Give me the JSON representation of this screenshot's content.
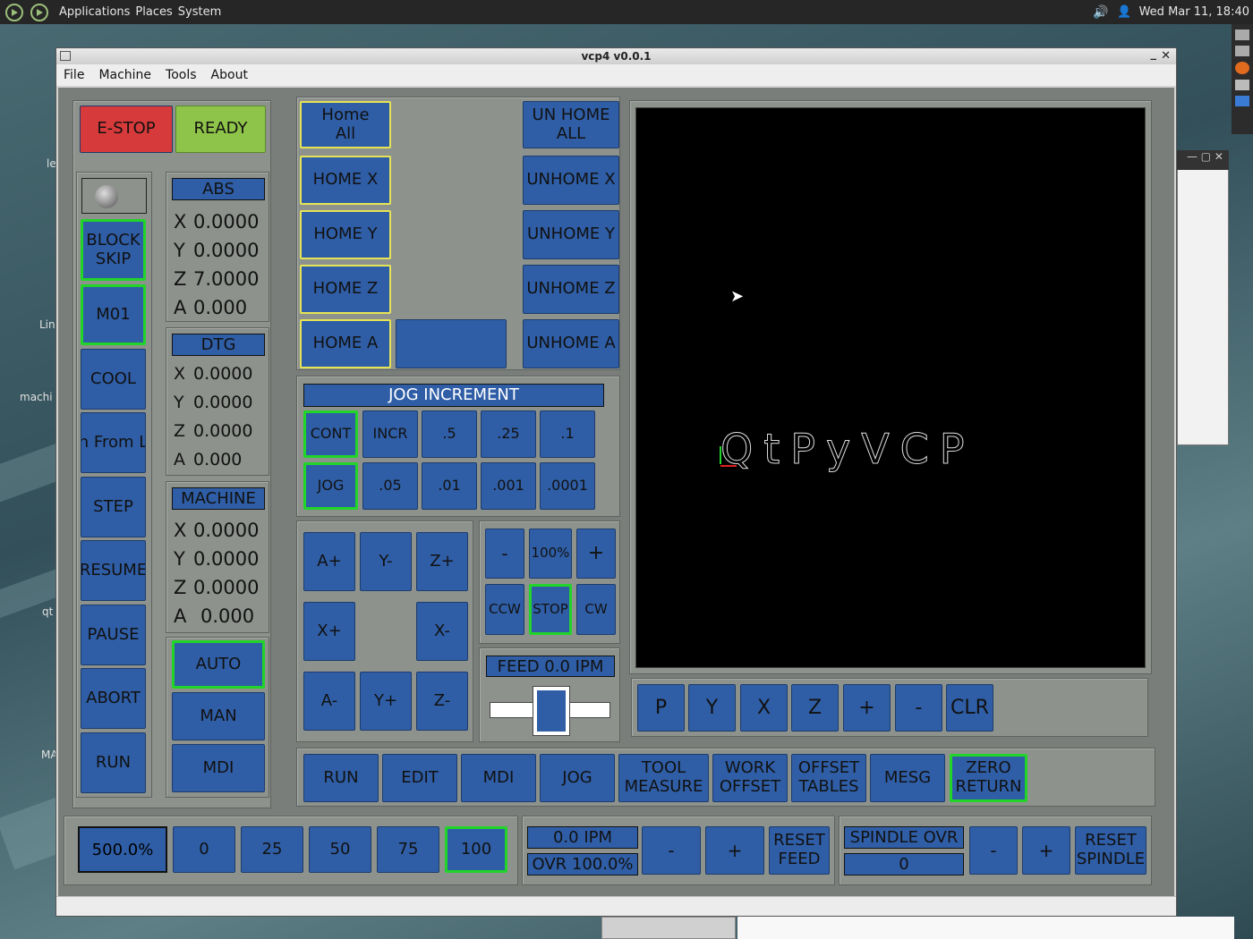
{
  "top_panel": {
    "menus": [
      "Applications",
      "Places",
      "System"
    ],
    "clock": "Wed Mar 11, 18:40"
  },
  "desktop_labels": [
    "le",
    "Lin",
    "machi",
    "qt",
    "MA"
  ],
  "window": {
    "title": "vcp4 v0.0.1",
    "menu": [
      "File",
      "Machine",
      "Tools",
      "About"
    ]
  },
  "estop_label": "E-STOP",
  "ready_label": "READY",
  "left_buttons": [
    "BLOCK\nSKIP",
    "M01",
    "COOL",
    "n From L",
    "STEP",
    "RESUME",
    "PAUSE",
    "ABORT",
    "RUN"
  ],
  "dro": {
    "abs_header": "ABS",
    "abs": [
      [
        "X",
        "0.0000"
      ],
      [
        "Y",
        "0.0000"
      ],
      [
        "Z",
        "7.0000"
      ],
      [
        "A",
        "0.000"
      ]
    ],
    "dtg_header": "DTG",
    "dtg": [
      [
        "X",
        "0.0000"
      ],
      [
        "Y",
        "0.0000"
      ],
      [
        "Z",
        "0.0000"
      ],
      [
        "A",
        "0.000"
      ]
    ],
    "machine_header": "MACHINE",
    "machine": [
      [
        "X",
        "0.0000"
      ],
      [
        "Y",
        "0.0000"
      ],
      [
        "Z",
        "0.0000"
      ],
      [
        "A",
        "0.000"
      ]
    ]
  },
  "mode_buttons": [
    "AUTO",
    "MAN",
    "MDI"
  ],
  "home": {
    "home_all": "Home\nAll",
    "unhome_all": "UN HOME\nALL",
    "home": [
      "HOME X",
      "HOME Y",
      "HOME Z",
      "HOME A"
    ],
    "unhome": [
      "UNHOME X",
      "UNHOME Y",
      "UNHOME Z",
      "UNHOME A"
    ]
  },
  "jog_increment": {
    "header": "JOG INCREMENT",
    "row1": [
      "CONT",
      "INCR",
      ".5",
      ".25",
      ".1"
    ],
    "row2": [
      "JOG",
      ".05",
      ".01",
      ".001",
      ".0001"
    ]
  },
  "jog_buttons": [
    "A+",
    "Y-",
    "Z+",
    "X+",
    "X-",
    "A-",
    "Y+",
    "Z-"
  ],
  "spindle_ctrl": {
    "minus": "-",
    "pct": "100%",
    "plus": "+",
    "ccw": "CCW",
    "stop": "STOP",
    "cw": "CW"
  },
  "feed": {
    "label": "FEED 0.0  IPM",
    "slider_position": 0.5
  },
  "preview": {
    "logo_text": "QtPyVCP",
    "view_buttons": [
      "P",
      "Y",
      "X",
      "Z",
      "+",
      "-",
      "CLR"
    ]
  },
  "tabs": [
    "RUN",
    "EDIT",
    "MDI",
    "JOG",
    "TOOL\nMEASURE",
    "WORK\nOFFSET",
    "OFFSET\nTABLES",
    "MESG",
    "ZERO\nRETURN"
  ],
  "rapid": {
    "value": "500.0%",
    "presets": [
      "0",
      "25",
      "50",
      "75",
      "100"
    ]
  },
  "feed_ovr": {
    "ipm": "0.0  IPM",
    "ovr": "OVR 100.0%",
    "minus": "-",
    "plus": "+",
    "reset": "RESET\nFEED"
  },
  "spindle_ovr": {
    "label": "SPINDLE OVR",
    "value": "0",
    "minus": "-",
    "plus": "+",
    "reset": "RESET\nSPINDLE"
  },
  "colors": {
    "button_blue": "#2f5ea6",
    "active_green": "#22d42a",
    "estop_red": "#d63a3a",
    "ready_green": "#8fc44a"
  }
}
